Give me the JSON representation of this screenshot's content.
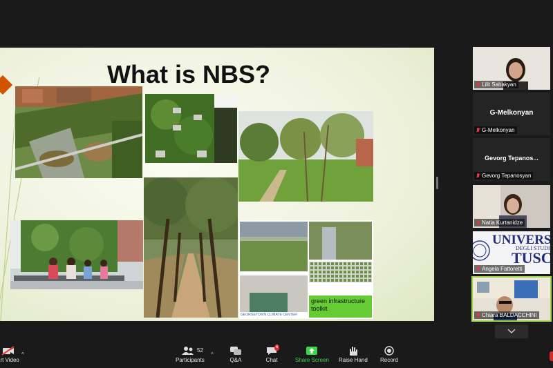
{
  "slide": {
    "title": "What is NBS?",
    "green_caption": "green infrastructure toolkit",
    "small_caption": "GEORGETOWN CLIMATE CENTER"
  },
  "participants": [
    {
      "name": "Lilit Sahakyan",
      "has_video": true,
      "muted": true
    },
    {
      "name": "G-Melkonyan",
      "display_name": "G-Melkonyan",
      "has_video": false,
      "muted": true
    },
    {
      "name": "Gevorg Tepanosyan",
      "display_name": "Gevorg  Tepanos...",
      "has_video": false,
      "muted": true
    },
    {
      "name": "Natia Kurtanidze",
      "has_video": true,
      "muted": true
    },
    {
      "name": "Angela Fattoretti",
      "has_video": true,
      "muted": true
    },
    {
      "name": "Chiara BALDACCHINI",
      "has_video": true,
      "muted": true,
      "active_speaker": true
    }
  ],
  "gallery_tile_text": {
    "univers": "UNIVERS",
    "degli": "DEGLI STUDI",
    "tusc": "TUSC"
  },
  "toolbar": {
    "video_label": "art Video",
    "participants_label": "Participants",
    "participants_count": "52",
    "qa_label": "Q&A",
    "chat_label": "Chat",
    "chat_badge": "6",
    "share_label": "Share Screen",
    "raise_label": "Raise Hand",
    "record_label": "Record"
  },
  "colors": {
    "toolbar_bg": "#1a1a1a",
    "share_green": "#3dd44a",
    "active_speaker_border": "#9fd64a",
    "mute_red": "#e23b3b",
    "caption_green": "#66cc33"
  }
}
